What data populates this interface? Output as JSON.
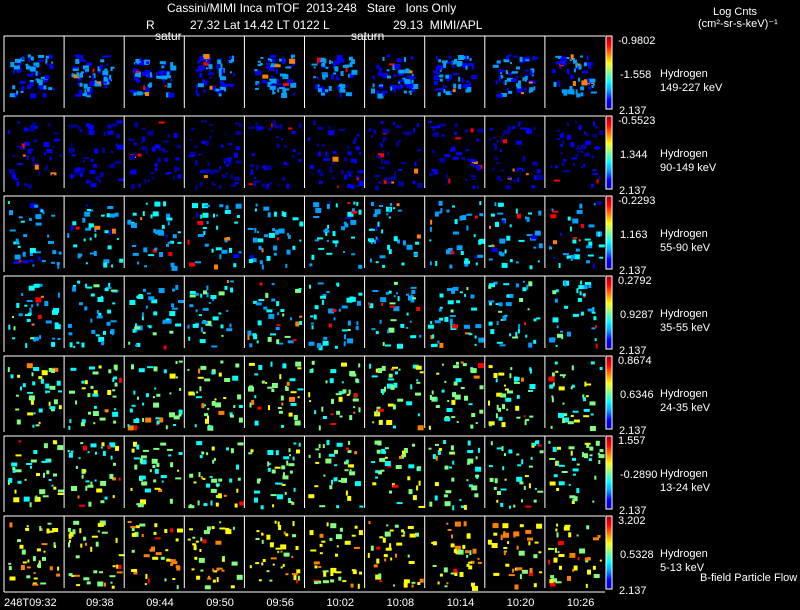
{
  "header": {
    "title": "Cassini/MIMI Inca mTOF  2013-248   Stare   Ions Only",
    "r_label": "R",
    "position_line": "27.32 Lat 14.42 LT 0122 L",
    "instrument_line": "29.13  MIMI/APL",
    "saturn_marker_1": "satur",
    "saturn_marker_2": "saturn"
  },
  "colorbar_units": {
    "line1": "Log Cnts",
    "line2": "(cm²-sr-s-keV)⁻¹"
  },
  "footer": {
    "flow_label": "B-field Particle Flow"
  },
  "colors": {
    "background": "#000000",
    "frame": "#ffffff",
    "colormap": [
      "#0000a0",
      "#0000ff",
      "#00a0ff",
      "#00ffff",
      "#80ff80",
      "#ffff00",
      "#ff8000",
      "#ff0000",
      "#a00000"
    ]
  },
  "chart_data": {
    "type": "heatmap",
    "title": "Cassini/MIMI Inca mTOF  2013-248   Stare   Ions Only",
    "time_labels": [
      "248T09:32",
      "09:38",
      "09:44",
      "09:50",
      "09:56",
      "10:02",
      "10:08",
      "10:14",
      "10:20",
      "10:26"
    ],
    "rows": [
      {
        "species": "Hydrogen",
        "energy": "149-227 keV",
        "cbar_max": "-0.9802",
        "cbar_mid": "-1.558",
        "cbar_min": "2.137",
        "dominant_level": 0.25
      },
      {
        "species": "Hydrogen",
        "energy": "90-149 keV",
        "cbar_max": "-0.5523",
        "cbar_mid": "1.344",
        "cbar_min": "2.137",
        "dominant_level": 0.12
      },
      {
        "species": "Hydrogen",
        "energy": "55-90 keV",
        "cbar_max": "-0.2293",
        "cbar_mid": "1.163",
        "cbar_min": "2.137",
        "dominant_level": 0.35
      },
      {
        "species": "Hydrogen",
        "energy": "35-55 keV",
        "cbar_max": "0.2792",
        "cbar_mid": "0.9287",
        "cbar_min": "2.137",
        "dominant_level": 0.4
      },
      {
        "species": "Hydrogen",
        "energy": "24-35 keV",
        "cbar_max": "0.8674",
        "cbar_mid": "0.6346",
        "cbar_min": "2.137",
        "dominant_level": 0.55
      },
      {
        "species": "Hydrogen",
        "energy": "13-24 keV",
        "cbar_max": "1.557",
        "cbar_mid": "-0.2890",
        "cbar_min": "2.137",
        "dominant_level": 0.55
      },
      {
        "species": "Hydrogen",
        "energy": "5-13 keV",
        "cbar_max": "3.202",
        "cbar_mid": "0.5328",
        "cbar_min": "2.137",
        "dominant_level": 0.68
      }
    ],
    "grid": false
  }
}
